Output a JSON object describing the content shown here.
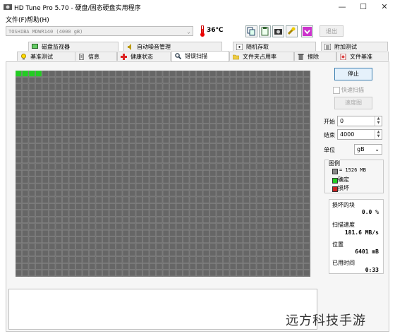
{
  "window": {
    "title": "HD Tune Pro 5.70 - 硬盘/固态硬盘实用程序",
    "controls": {
      "minimize": "—",
      "maximize": "☐",
      "close": "✕"
    }
  },
  "menu": {
    "file": "文件(F)",
    "help": "帮助(H)"
  },
  "toolbar": {
    "drive_value": "TOSHIBA MDWR140 (4000 gB)",
    "temperature": "36℃",
    "exit_label": "退出"
  },
  "tabs": {
    "row1": [
      "磁盘监视器",
      "自动噪音管理",
      "随机存取",
      "附加测试"
    ],
    "row2": [
      "基准测试",
      "信息",
      "健康状态",
      "错误扫描",
      "文件夹占用率",
      "擦除",
      "文件基准"
    ],
    "active": "错误扫描"
  },
  "controls": {
    "stop_label": "停止",
    "quick_scan_label": "快速扫描",
    "speed_label": "速度图",
    "start_label": "开始",
    "start_value": "0",
    "end_label": "结束",
    "end_value": "4000",
    "unit_label": "单位",
    "unit_value": "gB"
  },
  "legend": {
    "title": "图例",
    "block_size": "= 1526 MB",
    "ok": "确定",
    "bad": "损坏"
  },
  "stats": {
    "damaged_label": "损坏的块",
    "damaged_value": "0.0 %",
    "speed_label": "扫描速度",
    "speed_value": "181.6 MB/s",
    "position_label": "位置",
    "position_value": "6401 mB",
    "elapsed_label": "已用时间",
    "elapsed_value": "0:33"
  },
  "scan_grid": {
    "cols": 44,
    "rows": 31,
    "scanned_blocks": 4
  },
  "colors": {
    "scanned": "#22cc22",
    "unscanned": "#666666",
    "grid_line": "#9a9a9a",
    "bad": "#cc2222"
  },
  "watermark": "远方科技手游"
}
